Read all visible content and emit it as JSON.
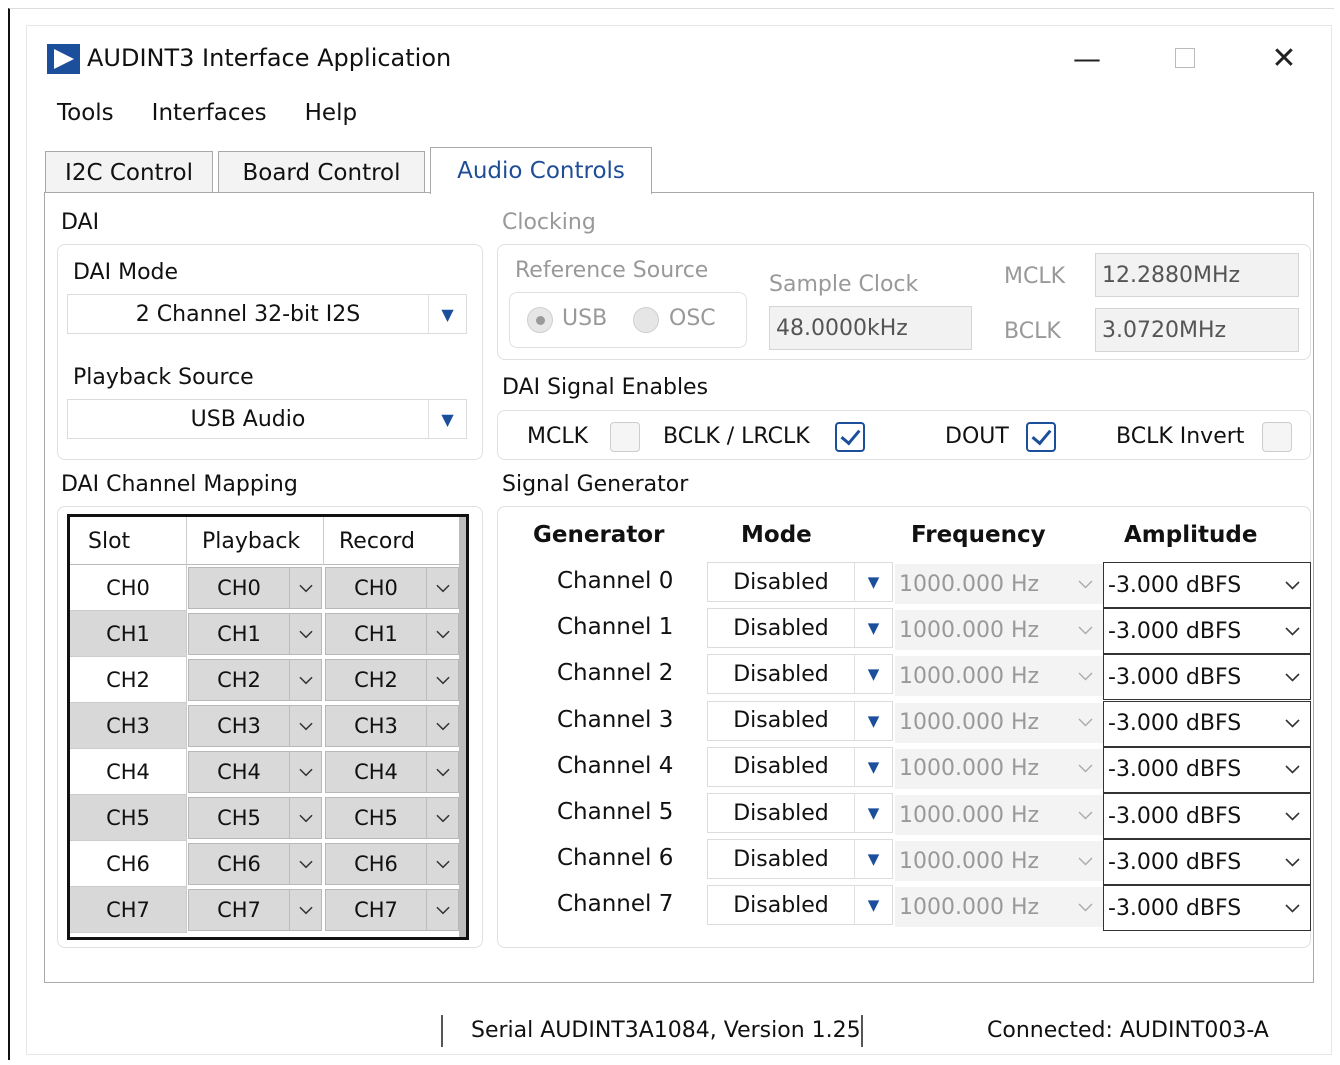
{
  "window": {
    "title": "AUDINT3 Interface Application",
    "min_glyph": "—",
    "close_glyph": "✕"
  },
  "menu": [
    "Tools",
    "Interfaces",
    "Help"
  ],
  "tabs": [
    {
      "label": "I2C Control",
      "active": false
    },
    {
      "label": "Board Control",
      "active": false
    },
    {
      "label": "Audio Controls",
      "active": true
    }
  ],
  "dai": {
    "section_label": "DAI",
    "mode_label": "DAI Mode",
    "mode_value": "2 Channel 32-bit I2S",
    "playback_label": "Playback Source",
    "playback_value": "USB Audio"
  },
  "clocking": {
    "section_label": "Clocking",
    "ref_source_label": "Reference Source",
    "ref_usb": "USB",
    "ref_osc": "OSC",
    "ref_selected": "USB",
    "sample_clock_label": "Sample Clock",
    "sample_clock_value": "48.0000kHz",
    "mclk_label": "MCLK",
    "mclk_value": "12.2880MHz",
    "bclk_label": "BCLK",
    "bclk_value": "3.0720MHz"
  },
  "signal_enables": {
    "section_label": "DAI Signal Enables",
    "items": [
      {
        "label": "MCLK",
        "checked": false
      },
      {
        "label": "BCLK / LRCLK",
        "checked": true
      },
      {
        "label": "DOUT",
        "checked": true
      },
      {
        "label": "BCLK Invert",
        "checked": false
      }
    ]
  },
  "mapping": {
    "section_label": "DAI Channel Mapping",
    "headers": [
      "Slot",
      "Playback",
      "Record"
    ],
    "rows": [
      {
        "slot": "CH0",
        "playback": "CH0",
        "record": "CH0"
      },
      {
        "slot": "CH1",
        "playback": "CH1",
        "record": "CH1"
      },
      {
        "slot": "CH2",
        "playback": "CH2",
        "record": "CH2"
      },
      {
        "slot": "CH3",
        "playback": "CH3",
        "record": "CH3"
      },
      {
        "slot": "CH4",
        "playback": "CH4",
        "record": "CH4"
      },
      {
        "slot": "CH5",
        "playback": "CH5",
        "record": "CH5"
      },
      {
        "slot": "CH6",
        "playback": "CH6",
        "record": "CH6"
      },
      {
        "slot": "CH7",
        "playback": "CH7",
        "record": "CH7"
      }
    ]
  },
  "generator": {
    "section_label": "Signal Generator",
    "headers": [
      "Generator",
      "Mode",
      "Frequency",
      "Amplitude"
    ],
    "rows": [
      {
        "name": "Channel 0",
        "mode": "Disabled",
        "frequency": "1000.000 Hz",
        "amplitude": "-3.000 dBFS"
      },
      {
        "name": "Channel 1",
        "mode": "Disabled",
        "frequency": "1000.000 Hz",
        "amplitude": "-3.000 dBFS"
      },
      {
        "name": "Channel 2",
        "mode": "Disabled",
        "frequency": "1000.000 Hz",
        "amplitude": "-3.000 dBFS"
      },
      {
        "name": "Channel 3",
        "mode": "Disabled",
        "frequency": "1000.000 Hz",
        "amplitude": "-3.000 dBFS"
      },
      {
        "name": "Channel 4",
        "mode": "Disabled",
        "frequency": "1000.000 Hz",
        "amplitude": "-3.000 dBFS"
      },
      {
        "name": "Channel 5",
        "mode": "Disabled",
        "frequency": "1000.000 Hz",
        "amplitude": "-3.000 dBFS"
      },
      {
        "name": "Channel 6",
        "mode": "Disabled",
        "frequency": "1000.000 Hz",
        "amplitude": "-3.000 dBFS"
      },
      {
        "name": "Channel 7",
        "mode": "Disabled",
        "frequency": "1000.000 Hz",
        "amplitude": "-3.000 dBFS"
      }
    ]
  },
  "status": {
    "serial": "Serial AUDINT3A1084, Version 1.25",
    "connection": "Connected: AUDINT003-A"
  },
  "colors": {
    "accent": "#1b4f9b",
    "active_tab_text": "#1f4e96",
    "disabled_text": "#999999"
  }
}
